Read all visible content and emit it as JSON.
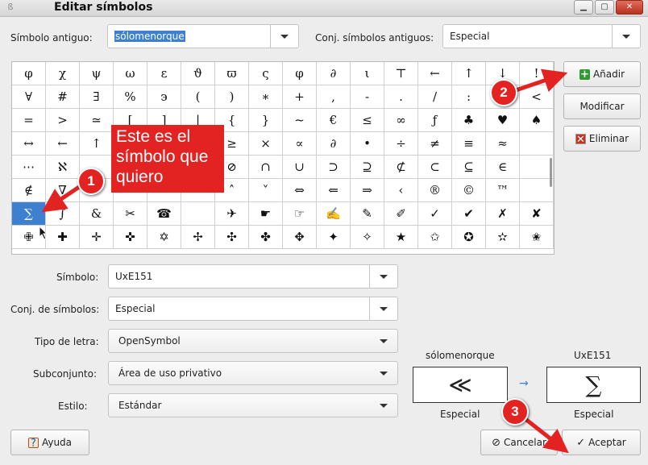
{
  "window": {
    "title": "Editar símbolos"
  },
  "old_symbol": {
    "label": "Símbolo antiguo:",
    "value": "sólomenorque"
  },
  "old_set": {
    "label": "Conj. símbolos antiguos:",
    "value": "Especial"
  },
  "grid": {
    "cells": [
      "φ",
      "χ",
      "ψ",
      "ω",
      "ε",
      "ϑ",
      "ϖ",
      "ς",
      "φ",
      "∂",
      "ι",
      "⊤",
      "←",
      "↑",
      "↓",
      "!",
      "∀",
      "#",
      "∃",
      "%",
      "϶",
      "(",
      ")",
      "∗",
      "+",
      ",",
      "-",
      ".",
      "/",
      ":",
      ";",
      "<",
      "=",
      ">",
      "≃",
      "[",
      "]",
      "|",
      "{",
      "}",
      "~",
      "€",
      "≤",
      "∞",
      "ƒ",
      "♣",
      "♥",
      "♠",
      "↔",
      "←",
      "↑",
      "",
      "",
      "±",
      "≥",
      "×",
      "∝",
      "∂",
      "•",
      "÷",
      "≠",
      "≡",
      "≈",
      "",
      "⋯",
      "ℵ",
      "",
      "",
      "",
      "⊕",
      "⊘",
      "∩",
      "∪",
      "⊃",
      "⊇",
      "⊄",
      "⊂",
      "⊆",
      "∈",
      "",
      "∉",
      "∇",
      "",
      "",
      "",
      "¬",
      "˄",
      "˅",
      "⇔",
      "⇐",
      "⇒",
      "‹",
      "®",
      "©",
      "™",
      "",
      "∑",
      "∫",
      "&",
      "✂",
      "☎",
      "",
      "✈",
      "☛",
      "☞",
      "✍",
      "✎",
      "✐",
      "✓",
      "✔",
      "✗",
      "✘",
      "✙",
      "✚",
      "✛",
      "✜",
      "✡",
      "✢",
      "✣",
      "✤",
      "✥",
      "✦",
      "✧",
      "★",
      "✩",
      "✪",
      "✫",
      "✬"
    ],
    "selected_index": 96
  },
  "buttons": {
    "add": "Añadir",
    "modify": "Modificar",
    "delete": "Eliminar",
    "help": "Ayuda",
    "cancel": "Cancelar",
    "accept": "Aceptar"
  },
  "fields": {
    "symbol": {
      "label": "Símbolo:",
      "value": "UxE151"
    },
    "symbol_set": {
      "label": "Conj. de símbolos:",
      "value": "Especial"
    },
    "font": {
      "label": "Tipo de letra:",
      "value": "OpenSymbol"
    },
    "subset": {
      "label": "Subconjunto:",
      "value": "Área de uso privativo"
    },
    "style": {
      "label": "Estilo:",
      "value": "Estándar"
    }
  },
  "preview": {
    "old_name": "sólomenorque",
    "old_glyph": "≪",
    "old_set": "Especial",
    "new_name": "UxE151",
    "new_glyph": "∑",
    "new_set": "Especial",
    "arrow": "→"
  },
  "annotations": {
    "callout_text": "Este es el símbolo que quiero",
    "badge1": "1",
    "badge2": "2",
    "badge3": "3",
    "color": "#e32322"
  },
  "colors": {
    "selection": "#3d80d0",
    "dialog_bg": "#ededed"
  }
}
